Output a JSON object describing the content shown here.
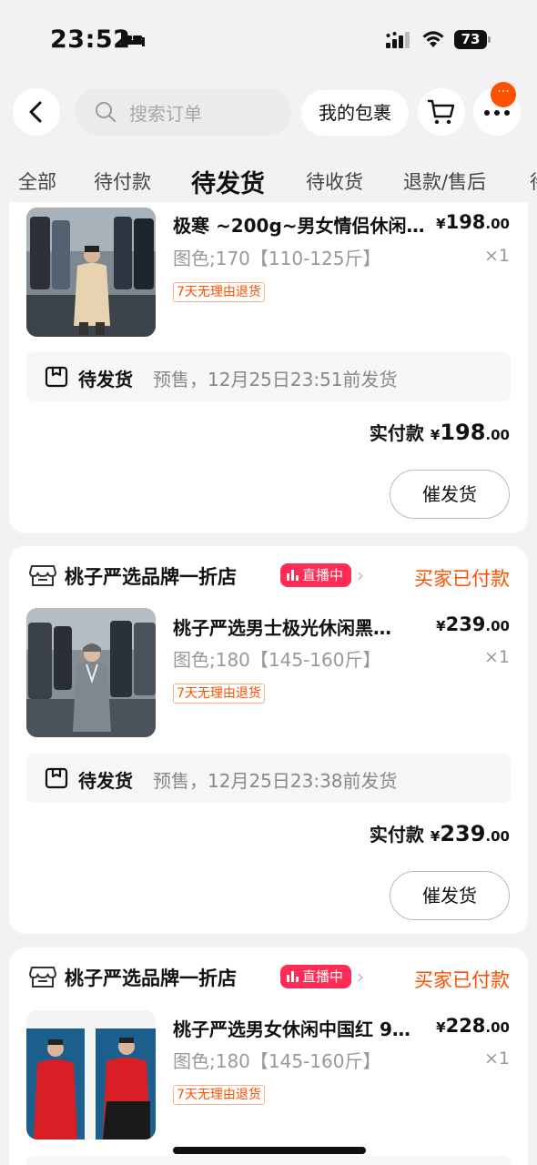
{
  "status_bar": {
    "time": "23:52",
    "battery": "73"
  },
  "header": {
    "search_placeholder": "搜索订单",
    "parcel_label": "我的包裹",
    "more_badge": "···"
  },
  "tabs": [
    {
      "label": "全部"
    },
    {
      "label": "待付款"
    },
    {
      "label": "待发货"
    },
    {
      "label": "待收货"
    },
    {
      "label": "退款/售后"
    },
    {
      "label": "待"
    }
  ],
  "active_tab": "待发货",
  "orders": [
    {
      "product_title": "极寒 ~200g~男女情侣休闲…",
      "price_symbol": "¥",
      "price_int": "198",
      "price_dec": ".00",
      "sku": "图色;170【110-125斤】",
      "qty": "×1",
      "return_tag": "7天无理由退货",
      "ship_label": "待发货",
      "ship_note": "预售，12月25日23:51前发货",
      "paid_label": "实付款",
      "paid_symbol": "¥",
      "paid_int": "198",
      "paid_dec": ".00",
      "urge_label": "催发货"
    },
    {
      "shop_name": "桃子严选品牌一折店",
      "live_label": "直播中",
      "status": "买家已付款",
      "product_title": "桃子严选男士极光休闲黑…",
      "price_symbol": "¥",
      "price_int": "239",
      "price_dec": ".00",
      "sku": "图色;180【145-160斤】",
      "qty": "×1",
      "return_tag": "7天无理由退货",
      "ship_label": "待发货",
      "ship_note": "预售，12月25日23:38前发货",
      "paid_label": "实付款",
      "paid_symbol": "¥",
      "paid_int": "239",
      "paid_dec": ".00",
      "urge_label": "催发货"
    },
    {
      "shop_name": "桃子严选品牌一折店",
      "live_label": "直播中",
      "status": "买家已付款",
      "product_title": "桃子严选男女休闲中国红 9…",
      "price_symbol": "¥",
      "price_int": "228",
      "price_dec": ".00",
      "sku": "图色;180【145-160斤】",
      "qty": "×1",
      "return_tag": "7天无理由退货"
    }
  ],
  "colors": {
    "accent": "#ff5000",
    "live": "#ff2d55"
  }
}
